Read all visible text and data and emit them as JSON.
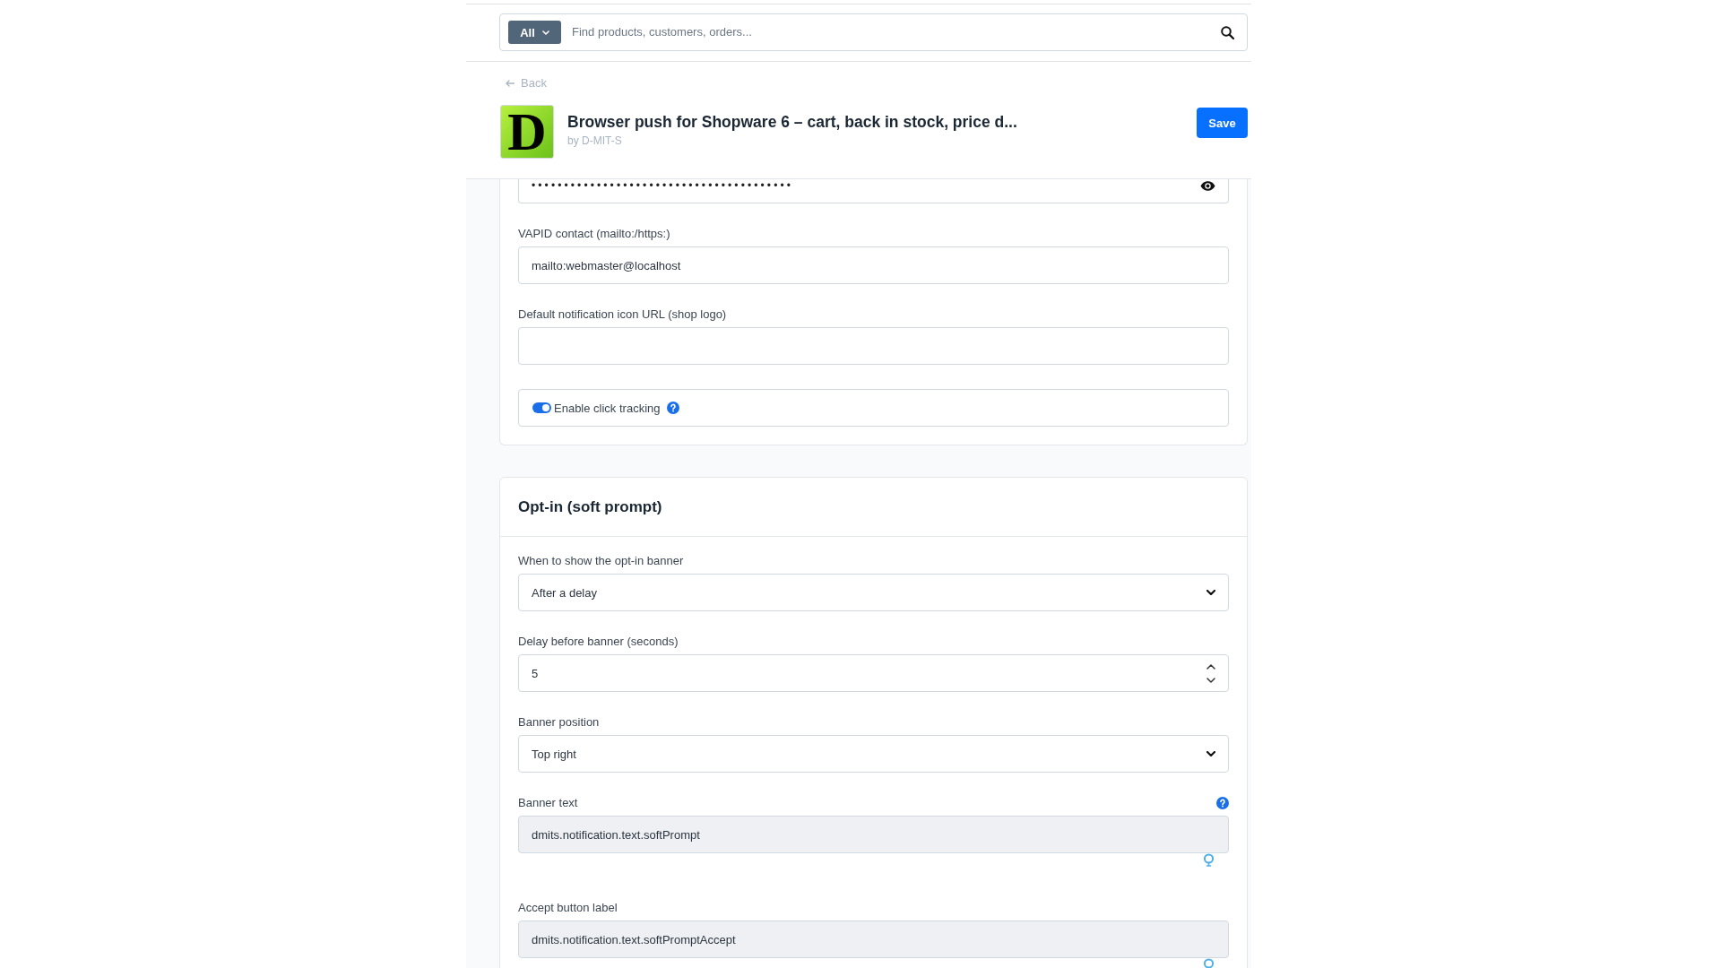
{
  "search": {
    "scope": "All",
    "placeholder": "Find products, customers, orders..."
  },
  "back_link": "Back",
  "plugin": {
    "logo_letter": "D",
    "title": "Browser push for Shopware 6 – cart, back in stock, price d...",
    "vendor": "by D-MIT-S"
  },
  "save_button": "Save",
  "settings_card": {
    "fields": [
      {
        "kind": "password",
        "value": "••••••••••••••••••••••••••••••••••••••••",
        "help": false
      },
      {
        "kind": "text",
        "label": "VAPID contact (mailto:/https:)",
        "value": "mailto:webmaster@localhost",
        "help": false
      },
      {
        "kind": "text",
        "label": "Default notification icon URL (shop logo)",
        "help": false
      },
      {
        "kind": "toggle",
        "label": "Enable click tracking",
        "on": true,
        "help": true
      }
    ]
  },
  "opt_in_card": {
    "title": "Opt-in (soft prompt)",
    "fields": [
      {
        "kind": "select",
        "label": "When to show the opt-in banner",
        "value": "After a delay",
        "help": false
      },
      {
        "kind": "number",
        "label": "Delay before banner (seconds)",
        "value": "5",
        "help": false
      },
      {
        "kind": "select",
        "label": "Banner position",
        "value": "Top right",
        "help": false
      },
      {
        "kind": "translation",
        "label": "Banner text",
        "value": "dmits.notification.text.softPrompt",
        "help": true
      },
      {
        "kind": "translation",
        "label": "Accept button label",
        "value": "dmits.notification.text.softPromptAccept",
        "help": false
      }
    ]
  }
}
